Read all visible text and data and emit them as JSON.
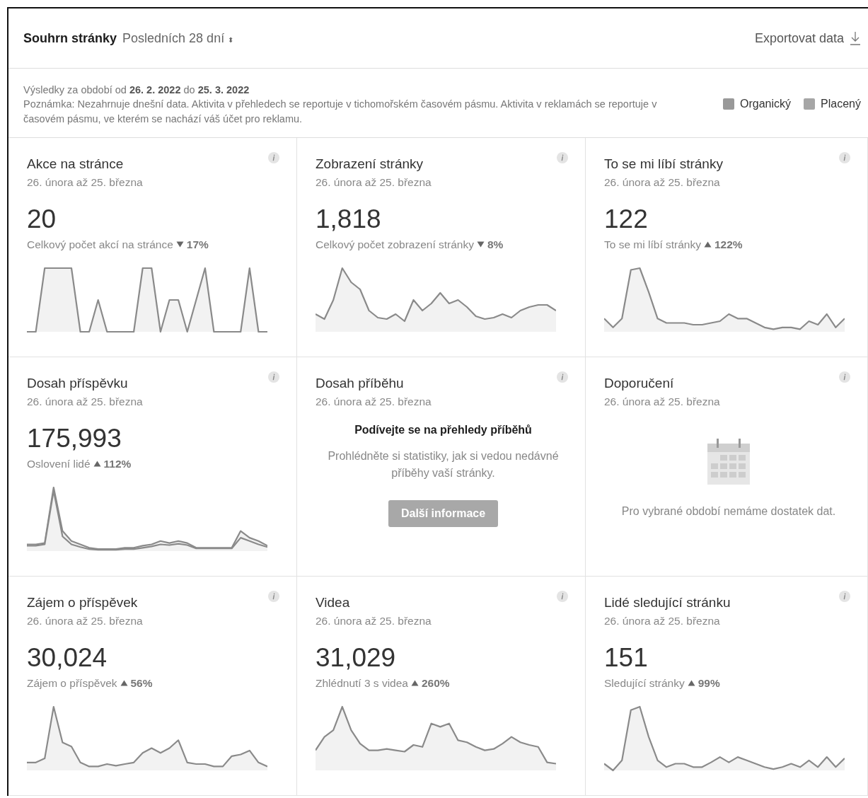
{
  "header": {
    "title": "Souhrn stránky",
    "period": "Posledních 28 dní",
    "period_caret": "⬍",
    "export": "Exportovat data"
  },
  "info": {
    "range": "Výsledky za období od **26. 2. 2022** do **25. 3. 2022**",
    "note": "Poznámka: Nezahrnuje dnešní data. Aktivita v přehledech se reportuje v tichomořském časovém pásmu. Aktivita v reklamách se reportuje v časovém pásmu, ve kterém se nachází váš účet pro reklamu.",
    "legend": [
      {
        "label": "Organický",
        "color": "#999999"
      },
      {
        "label": "Placený",
        "color": "#a6a6a6"
      }
    ]
  },
  "cards": [
    {
      "kind": "chart",
      "title": "Akce na stránce",
      "dates": "26. února až 25. března",
      "value": "20",
      "caption": "Celkový počet akcí na stránce",
      "increase": false,
      "change": "17%"
    },
    {
      "kind": "chart",
      "title": "Zobrazení stránky",
      "dates": "26. února až 25. března",
      "value": "1,818",
      "caption": "Celkový počet zobrazení stránky",
      "increase": false,
      "change": "8%"
    },
    {
      "kind": "chart",
      "title": "To se mi líbí stránky",
      "dates": "26. února až 25. března",
      "value": "122",
      "caption": "To se mi líbí stránky",
      "increase": true,
      "change": "122%"
    },
    {
      "kind": "chart",
      "title": "Dosah příspěvku",
      "dates": "26. února až 25. března",
      "value": "175,993",
      "caption": "Oslovení lidé",
      "increase": true,
      "change": "112%"
    },
    {
      "kind": "promo",
      "title": "Dosah příběhu",
      "dates": "26. února až 25. března",
      "heading": "Podívejte se na přehledy příběhů",
      "text": "Prohlédněte si statistiky, jak si vedou nedávné příběhy vaší stránky.",
      "button": "Další informace"
    },
    {
      "kind": "empty",
      "title": "Doporučení",
      "dates": "26. února až 25. března",
      "text": "Pro vybrané období nemáme dostatek dat."
    },
    {
      "kind": "chart",
      "title": "Zájem o příspěvek",
      "dates": "26. února až 25. března",
      "value": "30,024",
      "caption": "Zájem o příspěvek",
      "increase": true,
      "change": "56%"
    },
    {
      "kind": "chart",
      "title": "Videa",
      "dates": "26. února až 25. března",
      "value": "31,029",
      "caption": "Zhlédnutí 3 s videa",
      "increase": true,
      "change": "260%"
    },
    {
      "kind": "chart",
      "title": "Lidé sledující stránku",
      "dates": "26. února až 25. března",
      "value": "151",
      "caption": "Sledující stránky",
      "increase": true,
      "change": "99%"
    }
  ]
}
